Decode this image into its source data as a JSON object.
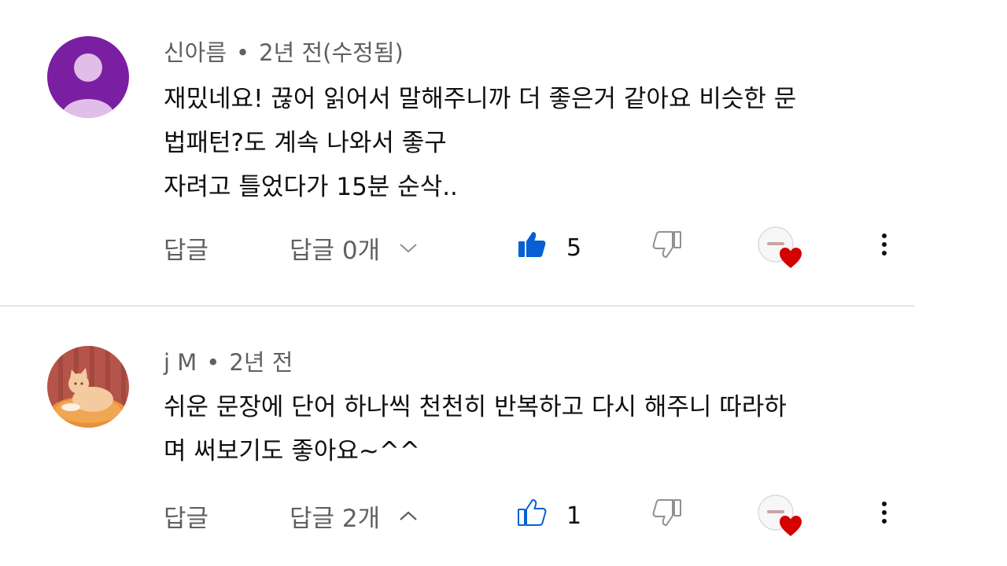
{
  "comments": [
    {
      "author": "신아름",
      "separator": "•",
      "time": "2년 전(수정됨)",
      "lines": [
        "재밌네요! 끊어 읽어서 말해주니까 더 좋은거 같아요 비슷한 문",
        "법패턴?도 계속 나와서 좋구",
        "자려고 틀었다가 15분 순삭.."
      ],
      "reply_label": "답글",
      "replies_label": "답글 0개",
      "like_count": "5",
      "liked": true,
      "replies_expanded": false,
      "avatar": "person-silhouette",
      "avatar_color": "#7b1fa2",
      "heart_color": "#d50000",
      "chevron_icon": "chevron-down-icon"
    },
    {
      "author": "j M",
      "separator": "•",
      "time": "2년 전",
      "lines": [
        "쉬운 문장에 단어 하나씩 천천히 반복하고 다시 해주니 따라하",
        "며 써보기도 좋아요~^^"
      ],
      "reply_label": "답글",
      "replies_label": "답글 2개",
      "like_count": "1",
      "liked": false,
      "replies_expanded": true,
      "avatar": "cat-photo",
      "heart_color": "#d50000",
      "chevron_icon": "chevron-up-icon"
    }
  ],
  "like_color": "#065fd4",
  "icon_color": "#909090"
}
